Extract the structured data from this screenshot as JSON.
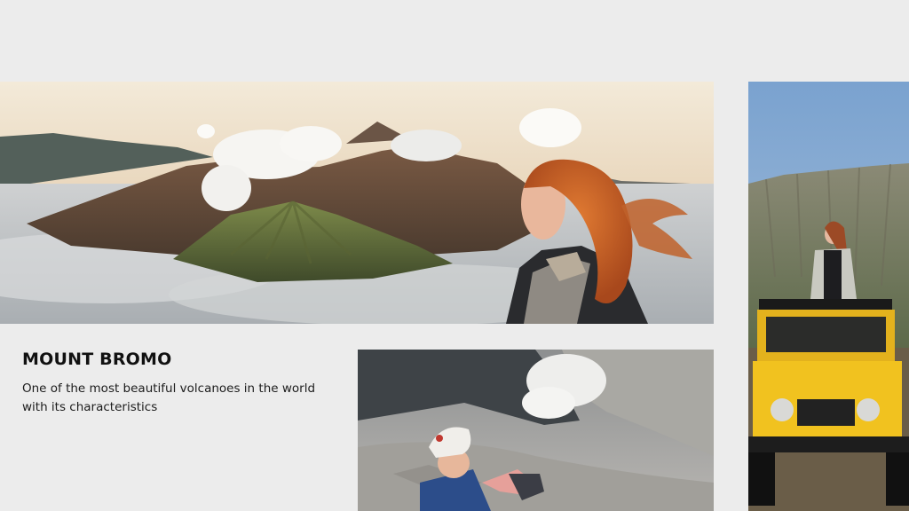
{
  "caption": {
    "title": "MOUNT BROMO",
    "description": "One of the most beautiful volcanoes in the world with its characteristics"
  }
}
